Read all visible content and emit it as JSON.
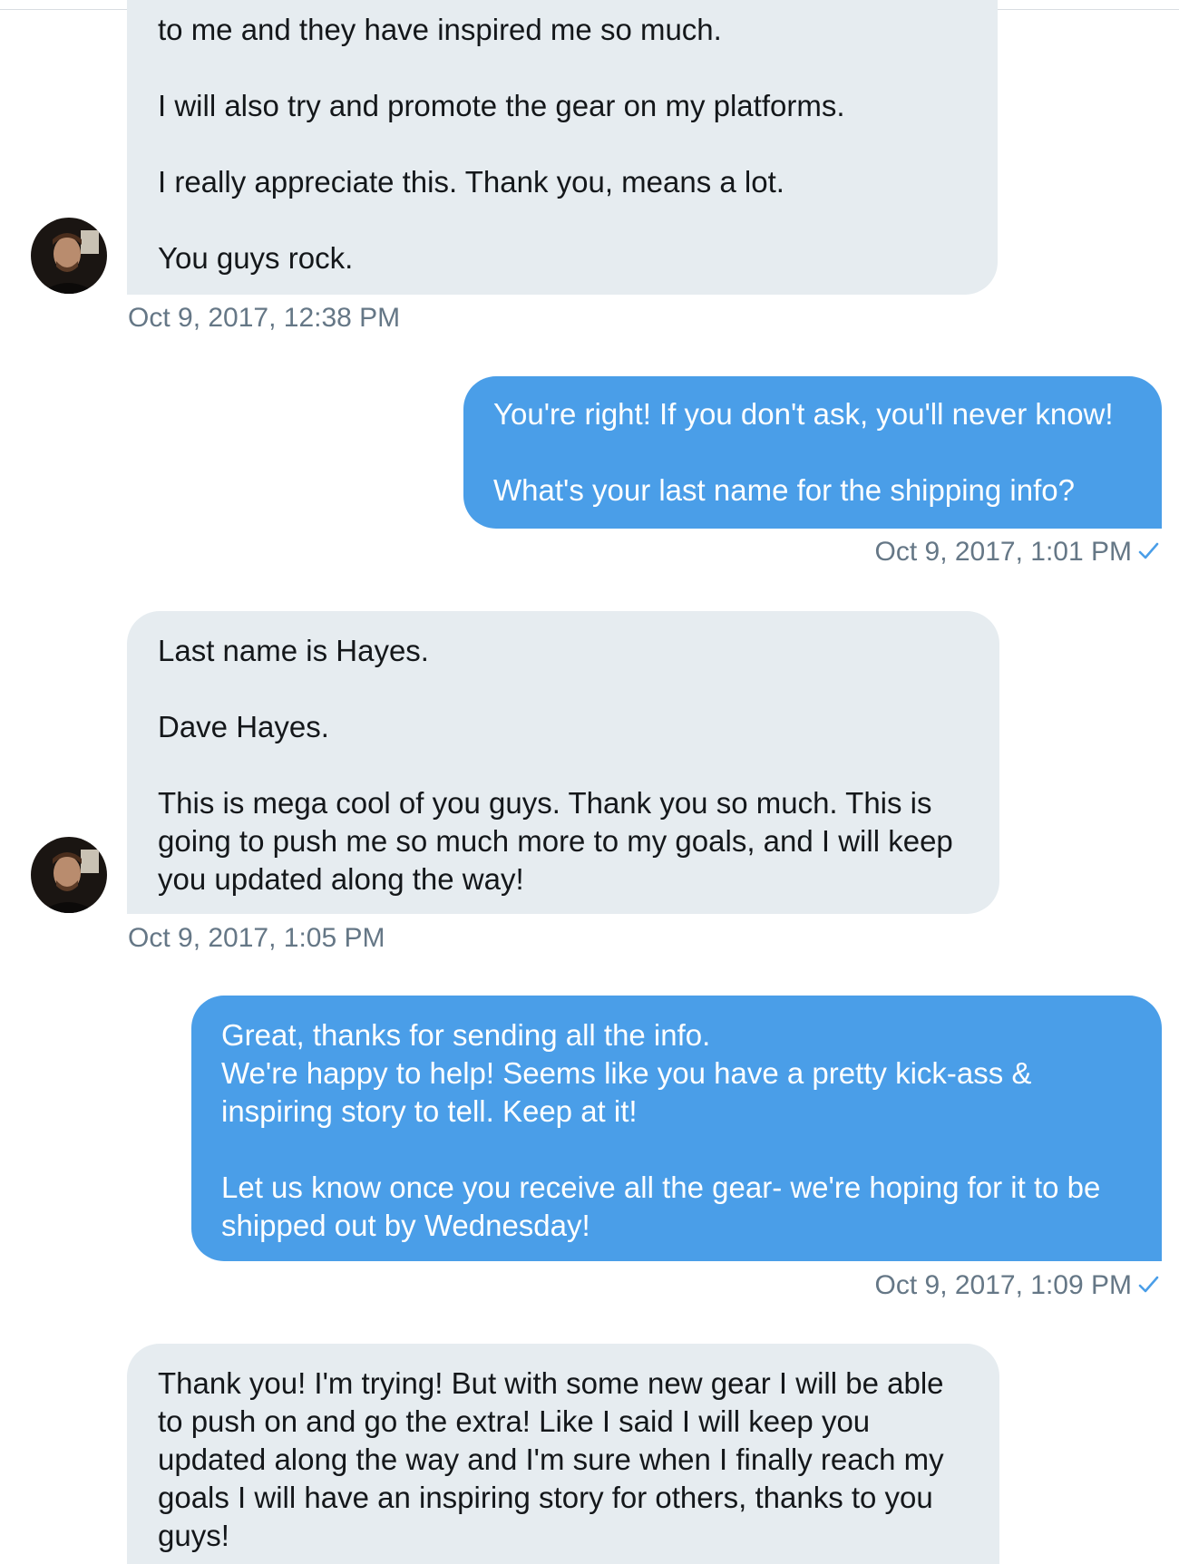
{
  "messages": [
    {
      "sender": "them",
      "text": "to me and they have inspired me so much.\n\nI will also try and promote the gear on my platforms.\n\nI really appreciate this. Thank you, means a lot.\n\nYou guys rock.",
      "timestamp": "Oct 9, 2017, 12:38 PM"
    },
    {
      "sender": "me",
      "text": "You're right! If you don't ask, you'll never know!\n\nWhat's your last name for the shipping info?",
      "timestamp": "Oct 9, 2017, 1:01 PM"
    },
    {
      "sender": "them",
      "text": "Last name is Hayes.\n\nDave Hayes.\n\nThis is mega cool of you guys. Thank you so much. This is going to push me so much more to my goals, and I will keep you updated along the way!",
      "timestamp": "Oct 9, 2017, 1:05 PM"
    },
    {
      "sender": "me",
      "text": "Great, thanks for sending all the info.\nWe're happy to help! Seems like you have a pretty kick-ass & inspiring story to tell. Keep at it!\n\nLet us know once you receive all the gear- we're hoping for it to be shipped out by Wednesday!",
      "timestamp": "Oct 9, 2017, 1:09 PM"
    },
    {
      "sender": "them",
      "text": "Thank you! I'm trying! But with some new gear I will be able to push on and go the extra! Like I said I will keep you updated along the way and I'm sure when I finally reach my goals I will have an inspiring story for others, thanks to you guys!"
    }
  ],
  "colors": {
    "incoming_bubble": "#e6ecf0",
    "outgoing_bubble": "#4a9ee8",
    "timestamp": "#657786",
    "read_check": "#4a9ee8"
  },
  "icons": {
    "avatar": "user-avatar",
    "read_receipt": "check-icon"
  }
}
